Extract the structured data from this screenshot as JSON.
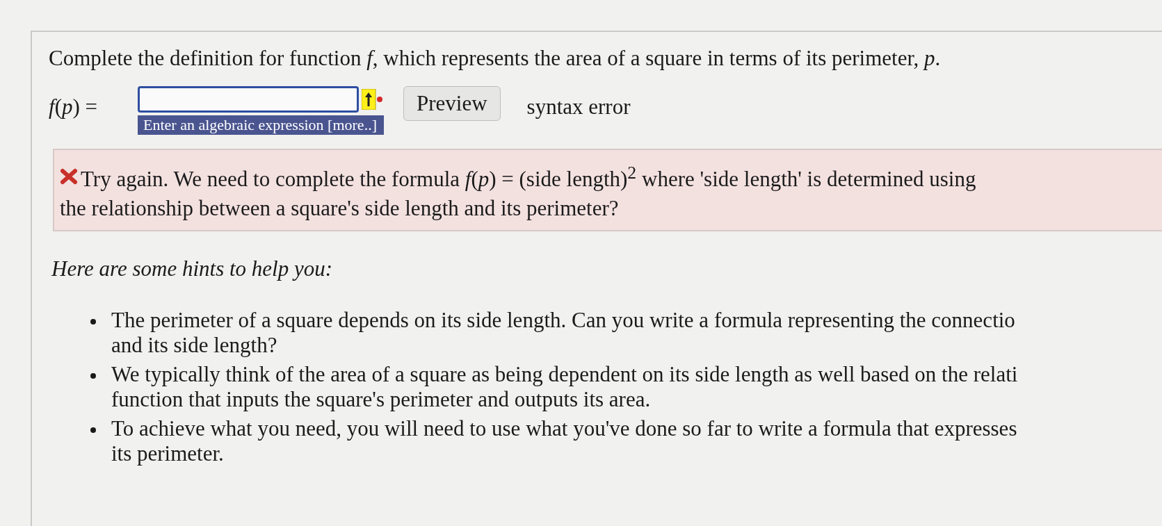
{
  "question": "Complete the definition for function *f*, which represents the area of a square in terms of its perimeter, *p*.",
  "answer": {
    "label": "*f*(*p*) =",
    "hint": "Enter an algebraic expression [more..]",
    "focused": true
  },
  "preview_button": "Preview",
  "status": "syntax error",
  "feedback": {
    "correct": false,
    "lines": [
      "Try again. We need to complete the formula *f*(*p*) = (side length)$^{2}$ where 'side length' is determined using",
      "the relationship between a square's side length and its perimeter?"
    ]
  },
  "hints_heading": "Here are some hints to help you:",
  "hints": [
    {
      "lines": [
        "The perimeter of a square depends on its side length. Can you write a formula representing the connectio",
        "and its side length?"
      ]
    },
    {
      "lines": [
        "We typically think of the area of a square as being dependent on its side length as well based on the relati",
        "function that inputs the square's perimeter and outputs its area."
      ]
    },
    {
      "lines": [
        "To achieve what you need, you will need to use what you've done so far to write a formula that expresses",
        "its perimeter."
      ]
    }
  ]
}
